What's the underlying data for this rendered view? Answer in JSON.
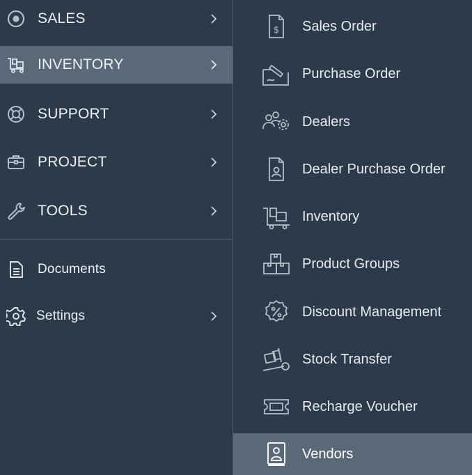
{
  "colors": {
    "background": "#2c3a4a",
    "active_background": "#5a6877",
    "icon": "#b4bec8",
    "text": "#e9eef3"
  },
  "left_menu": {
    "items": [
      {
        "label": "SALES",
        "icon": "target-icon",
        "has_submenu": true
      },
      {
        "label": "INVENTORY",
        "icon": "cart-icon",
        "has_submenu": true,
        "active": true
      },
      {
        "label": "SUPPORT",
        "icon": "lifebuoy-icon",
        "has_submenu": true
      },
      {
        "label": "PROJECT",
        "icon": "briefcase-icon",
        "has_submenu": true
      },
      {
        "label": "TOOLS",
        "icon": "wrench-icon",
        "has_submenu": true
      }
    ],
    "secondary": [
      {
        "label": "Documents",
        "icon": "document-icon",
        "has_submenu": false
      },
      {
        "label": "Settings",
        "icon": "gear-icon",
        "has_submenu": true
      }
    ]
  },
  "submenu": {
    "items": [
      {
        "label": "Sales Order",
        "icon": "invoice-dollar-icon"
      },
      {
        "label": "Purchase Order",
        "icon": "signed-document-icon"
      },
      {
        "label": "Dealers",
        "icon": "users-gear-icon"
      },
      {
        "label": "Dealer Purchase Order",
        "icon": "document-user-icon"
      },
      {
        "label": "Inventory",
        "icon": "cart-icon"
      },
      {
        "label": "Product Groups",
        "icon": "stacked-boxes-icon"
      },
      {
        "label": "Discount Management",
        "icon": "percent-badge-icon"
      },
      {
        "label": "Stock Transfer",
        "icon": "hand-truck-icon"
      },
      {
        "label": "Recharge Voucher",
        "icon": "ticket-icon"
      },
      {
        "label": "Vendors",
        "icon": "contact-book-icon",
        "active": true
      }
    ]
  }
}
